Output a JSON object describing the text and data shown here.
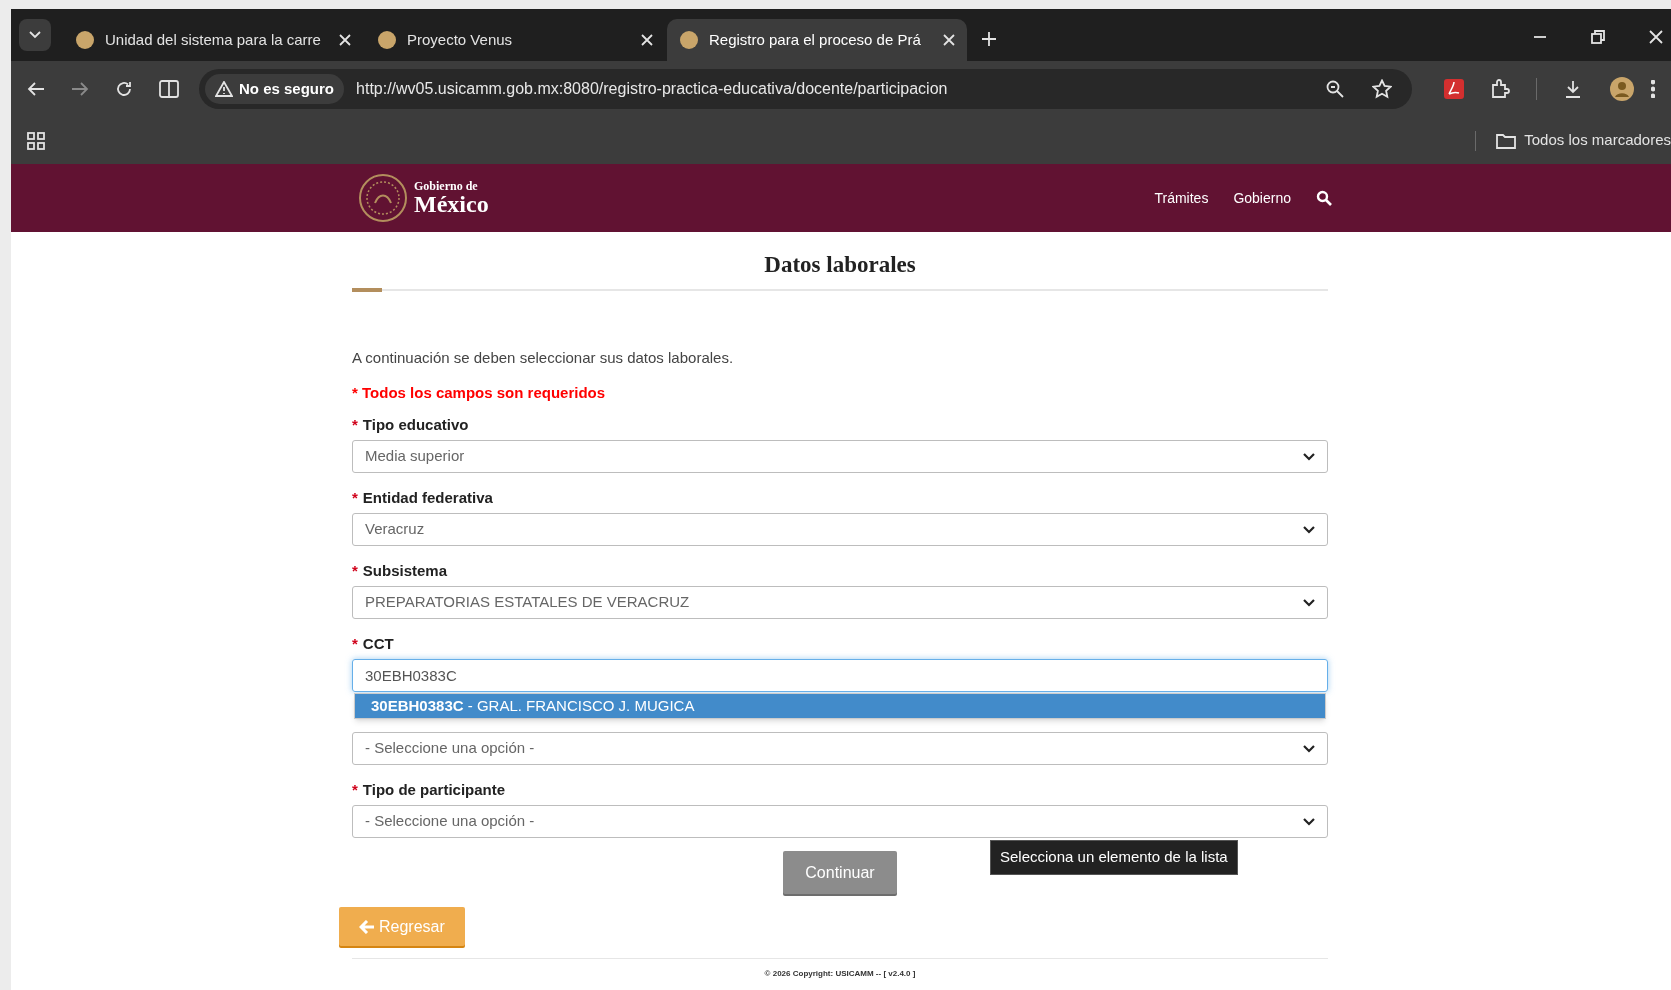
{
  "browser": {
    "tabs": [
      {
        "title": "Unidad del sistema para la carre",
        "selected": false
      },
      {
        "title": "Proyecto Venus",
        "selected": false
      },
      {
        "title": "Registro para el proceso de Prá",
        "selected": true
      }
    ],
    "security_chip": "No es seguro",
    "url": "http://wv05.usicamm.gob.mx:8080/registro-practica-educativa/docente/participacion",
    "bookmarks_folder": "Todos los marcadores"
  },
  "site_header": {
    "logo_top": "Gobierno de",
    "logo_bottom": "México",
    "nav": [
      "Trámites",
      "Gobierno"
    ]
  },
  "page": {
    "title": "Datos laborales",
    "intro": "A continuación se deben seleccionar sus datos laborales.",
    "required_note": "* Todos los campos son requeridos",
    "fields": [
      {
        "kind": "select",
        "marker": "*",
        "label": "Tipo educativo",
        "value": "Media superior"
      },
      {
        "kind": "select",
        "marker": "*",
        "label": "Entidad federativa",
        "value": "Veracruz"
      },
      {
        "kind": "select",
        "marker": "*",
        "label": "Subsistema",
        "value": "PREPARATORIAS ESTATALES DE VERACRUZ"
      },
      {
        "kind": "text",
        "marker": "*",
        "label": "CCT",
        "value": "30EBH0383C",
        "suggestions": [
          {
            "text": "**30EBH0383C** - GRAL. FRANCISCO J. MUGICA",
            "selected": true
          }
        ]
      },
      {
        "kind": "select",
        "value": "- Seleccione una opción -"
      },
      {
        "kind": "select",
        "marker": "*",
        "label": "Tipo de participante",
        "value": "- Seleccione una opción -"
      }
    ],
    "continue_button": "Continuar",
    "tooltip": "Selecciona un elemento de la lista",
    "back_button": "Regresar",
    "footer": "© 2026 Copyright: USICAMM -- [ v2.4.0 ]"
  }
}
